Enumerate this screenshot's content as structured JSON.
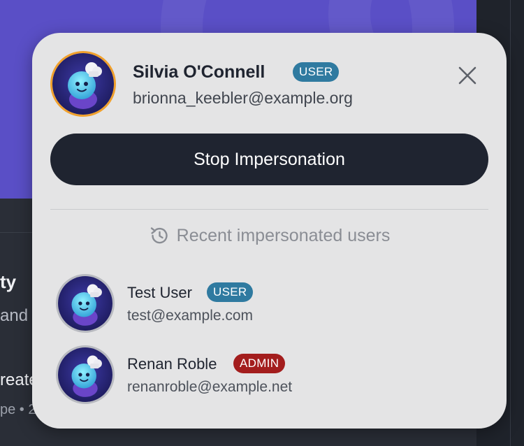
{
  "background": {
    "card_title_fragment": "ty",
    "card_text_fragment": "and",
    "card_link_fragment": "reate",
    "card_meta_fragment": "pe • 2"
  },
  "current_user": {
    "name": "Silvia O'Connell",
    "role": "USER",
    "email": "brionna_keebler@example.org"
  },
  "stop_button_label": "Stop Impersonation",
  "recent_heading": "Recent impersonated users",
  "recent_users": [
    {
      "name": "Test User",
      "role": "USER",
      "email": "test@example.com"
    },
    {
      "name": "Renan Roble",
      "role": "ADMIN",
      "email": "renanroble@example.net"
    }
  ],
  "colors": {
    "accent_current_avatar_ring": "#f0a02c",
    "badge_user": "#2f7aa0",
    "badge_admin": "#a31d1d",
    "primary_button": "#1f2430",
    "hero_background": "#5a4fc6"
  },
  "icons": {
    "close": "close-icon",
    "history": "history-icon",
    "avatar": "chef-mascot-avatar"
  }
}
